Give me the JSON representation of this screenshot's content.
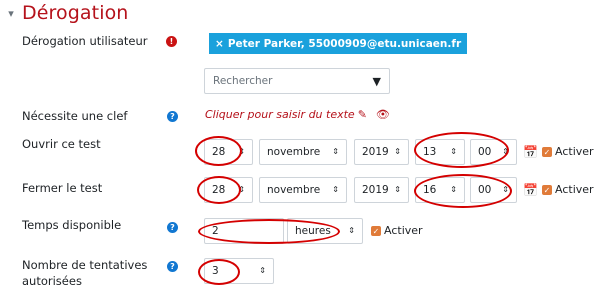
{
  "section": {
    "title": "Dérogation",
    "collapse_icon": "chevron-down-icon"
  },
  "fields": {
    "user": {
      "label": "Dérogation utilisateur",
      "chip": "Peter Parker, 55000909@etu.unicaen.fr",
      "chip_remove": "×",
      "search_placeholder": "Rechercher",
      "required_icon": "!"
    },
    "password": {
      "label": "Nécessite une clef",
      "value": "Cliquer pour saisir du texte"
    },
    "open": {
      "label": "Ouvrir ce test",
      "day": "28",
      "month": "novembre",
      "year": "2019",
      "hour": "13",
      "minute": "00",
      "enable": "Activer"
    },
    "close": {
      "label": "Fermer le test",
      "day": "28",
      "month": "novembre",
      "year": "2019",
      "hour": "16",
      "minute": "00",
      "enable": "Activer"
    },
    "timelimit": {
      "label": "Temps disponible",
      "value": "2",
      "unit": "heures",
      "enable": "Activer"
    },
    "attempts": {
      "label_line1": "Nombre de tentatives",
      "label_line2": "autorisées",
      "value": "3"
    }
  },
  "icons": {
    "help": "?",
    "check": "✓",
    "calendar": "calendar-icon",
    "pencil": "pencil-icon",
    "eye": "eye-icon"
  },
  "colors": {
    "accent": "#b5121b",
    "chip": "#1aa1dc",
    "help": "#1177d1",
    "annotation": "#d40000",
    "checkbox": "#e07b39"
  }
}
